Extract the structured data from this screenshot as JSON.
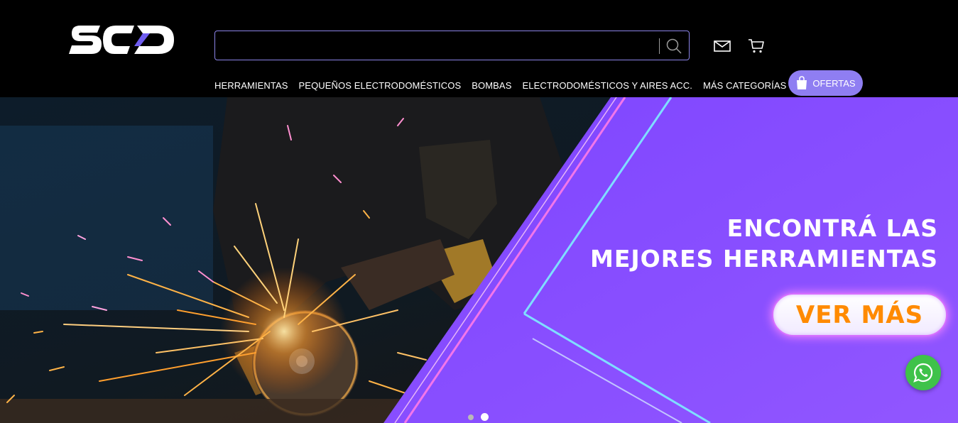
{
  "brand": {
    "logo_text": "SCD"
  },
  "search": {
    "placeholder": "",
    "value": ""
  },
  "header": {
    "icons": [
      "search-icon",
      "mail-icon",
      "cart-icon"
    ]
  },
  "nav": {
    "items": [
      {
        "label": "HERRAMIENTAS"
      },
      {
        "label": "PEQUEÑOS ELECTRODOMÉSTICOS"
      },
      {
        "label": "BOMBAS"
      },
      {
        "label": "ELECTRODOMÉSTICOS Y AIRES ACC."
      },
      {
        "label": "MÁS CATEGORÍAS"
      }
    ],
    "offers_label": "OFERTAS"
  },
  "hero": {
    "headline_line1": "ENCONTRÁ LAS",
    "headline_line2": "MEJORES HERRAMIENTAS",
    "cta_label": "VER MÁS",
    "slides_count": 2,
    "active_slide": 2
  },
  "colors": {
    "accent": "#8f7ef2",
    "hero_purple": "#8b4dff",
    "cta_text": "#ff8a00",
    "whatsapp": "#3fc24a"
  }
}
